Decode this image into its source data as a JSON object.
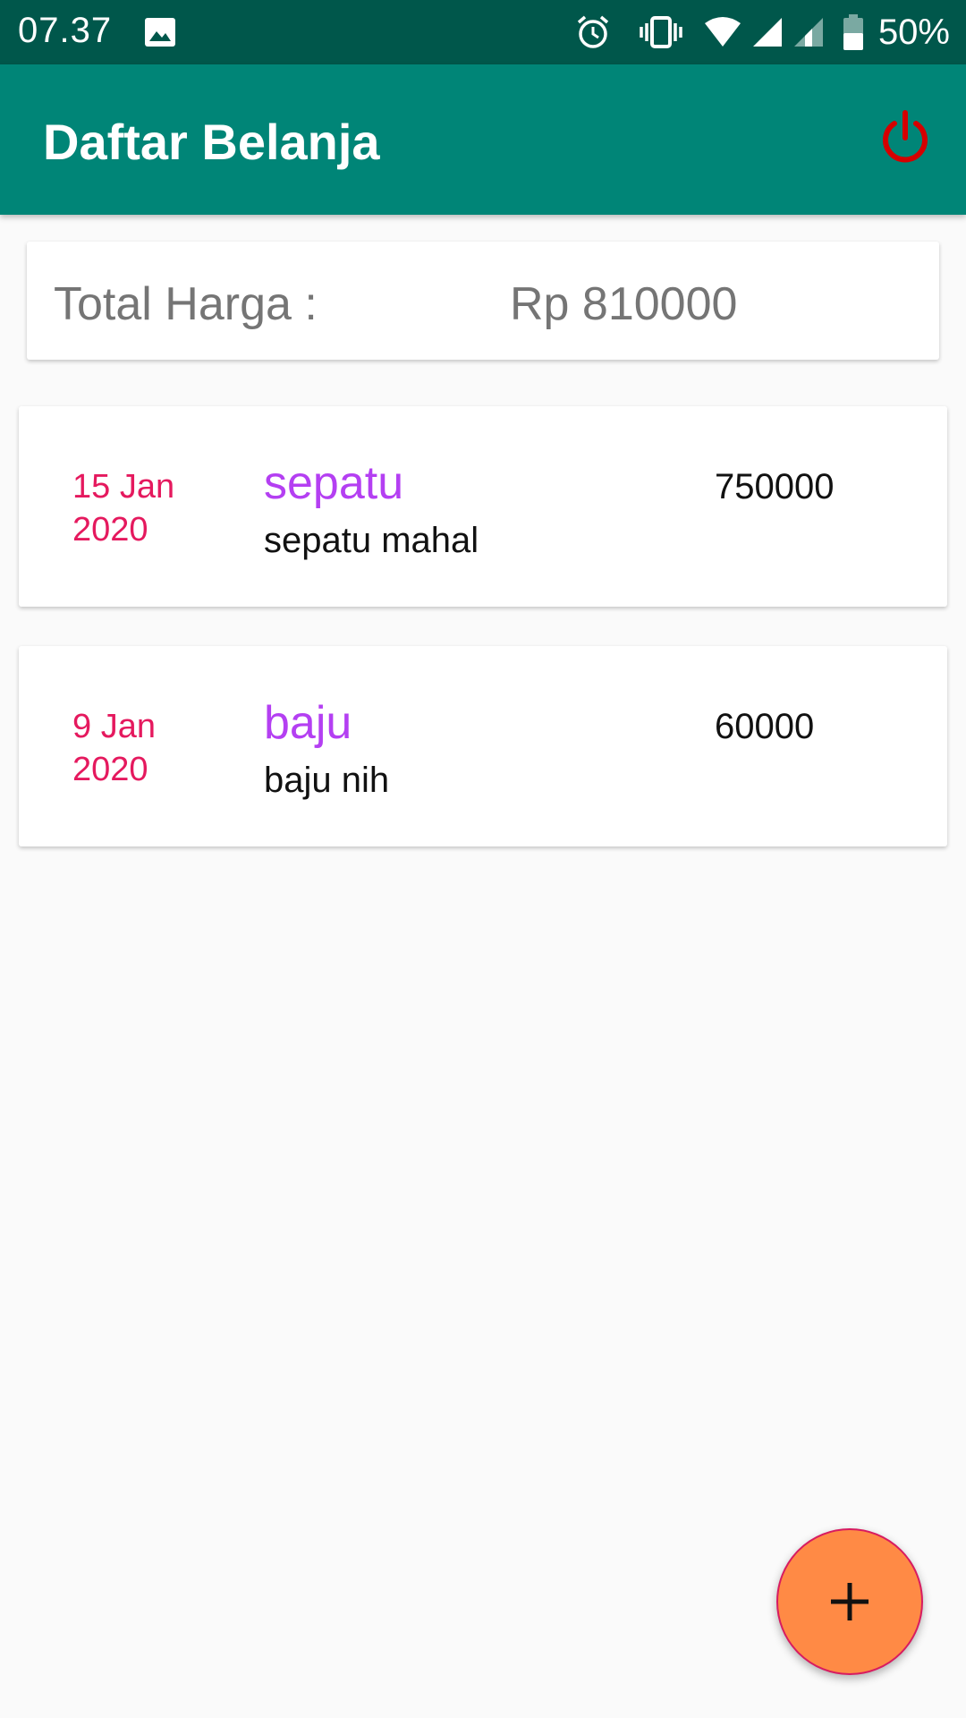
{
  "status_bar": {
    "time": "07.37",
    "battery": "50%",
    "icons": [
      "gallery-icon",
      "alarm-icon",
      "vibrate-icon",
      "wifi-icon",
      "signal-icon",
      "signal-icon-2",
      "battery-icon"
    ]
  },
  "app_bar": {
    "title": "Daftar Belanja",
    "power_icon": "power-icon",
    "power_color": "#d50000"
  },
  "total": {
    "label": "Total Harga :",
    "value": "Rp 810000"
  },
  "items": [
    {
      "date": "15 Jan 2020",
      "name": "sepatu",
      "description": "sepatu mahal",
      "price": "750000"
    },
    {
      "date": "9 Jan 2020",
      "name": "baju",
      "description": "baju nih",
      "price": "60000"
    }
  ],
  "fab": {
    "icon": "plus-icon",
    "color": "#ff8a45"
  },
  "colors": {
    "status_bar": "#00574b",
    "app_bar": "#008577",
    "date": "#e5195e",
    "item_name": "#b43ff2"
  }
}
